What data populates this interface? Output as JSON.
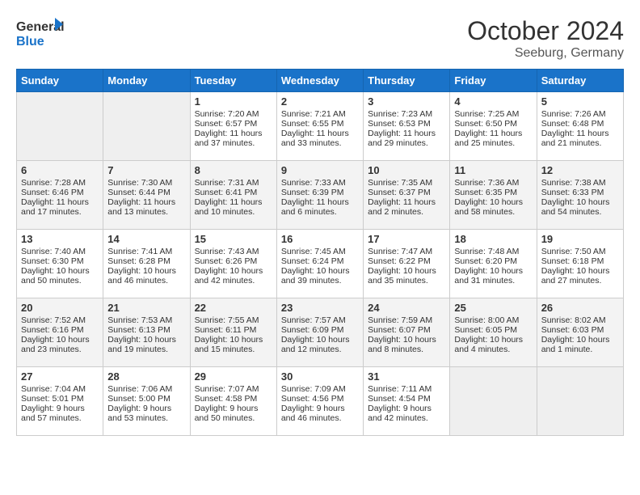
{
  "header": {
    "logo_line1": "General",
    "logo_line2": "Blue",
    "month_title": "October 2024",
    "location": "Seeburg, Germany"
  },
  "days_of_week": [
    "Sunday",
    "Monday",
    "Tuesday",
    "Wednesday",
    "Thursday",
    "Friday",
    "Saturday"
  ],
  "weeks": [
    [
      {
        "day": "",
        "empty": true
      },
      {
        "day": "",
        "empty": true
      },
      {
        "day": "1",
        "sunrise": "Sunrise: 7:20 AM",
        "sunset": "Sunset: 6:57 PM",
        "daylight": "Daylight: 11 hours and 37 minutes."
      },
      {
        "day": "2",
        "sunrise": "Sunrise: 7:21 AM",
        "sunset": "Sunset: 6:55 PM",
        "daylight": "Daylight: 11 hours and 33 minutes."
      },
      {
        "day": "3",
        "sunrise": "Sunrise: 7:23 AM",
        "sunset": "Sunset: 6:53 PM",
        "daylight": "Daylight: 11 hours and 29 minutes."
      },
      {
        "day": "4",
        "sunrise": "Sunrise: 7:25 AM",
        "sunset": "Sunset: 6:50 PM",
        "daylight": "Daylight: 11 hours and 25 minutes."
      },
      {
        "day": "5",
        "sunrise": "Sunrise: 7:26 AM",
        "sunset": "Sunset: 6:48 PM",
        "daylight": "Daylight: 11 hours and 21 minutes."
      }
    ],
    [
      {
        "day": "6",
        "sunrise": "Sunrise: 7:28 AM",
        "sunset": "Sunset: 6:46 PM",
        "daylight": "Daylight: 11 hours and 17 minutes."
      },
      {
        "day": "7",
        "sunrise": "Sunrise: 7:30 AM",
        "sunset": "Sunset: 6:44 PM",
        "daylight": "Daylight: 11 hours and 13 minutes."
      },
      {
        "day": "8",
        "sunrise": "Sunrise: 7:31 AM",
        "sunset": "Sunset: 6:41 PM",
        "daylight": "Daylight: 11 hours and 10 minutes."
      },
      {
        "day": "9",
        "sunrise": "Sunrise: 7:33 AM",
        "sunset": "Sunset: 6:39 PM",
        "daylight": "Daylight: 11 hours and 6 minutes."
      },
      {
        "day": "10",
        "sunrise": "Sunrise: 7:35 AM",
        "sunset": "Sunset: 6:37 PM",
        "daylight": "Daylight: 11 hours and 2 minutes."
      },
      {
        "day": "11",
        "sunrise": "Sunrise: 7:36 AM",
        "sunset": "Sunset: 6:35 PM",
        "daylight": "Daylight: 10 hours and 58 minutes."
      },
      {
        "day": "12",
        "sunrise": "Sunrise: 7:38 AM",
        "sunset": "Sunset: 6:33 PM",
        "daylight": "Daylight: 10 hours and 54 minutes."
      }
    ],
    [
      {
        "day": "13",
        "sunrise": "Sunrise: 7:40 AM",
        "sunset": "Sunset: 6:30 PM",
        "daylight": "Daylight: 10 hours and 50 minutes."
      },
      {
        "day": "14",
        "sunrise": "Sunrise: 7:41 AM",
        "sunset": "Sunset: 6:28 PM",
        "daylight": "Daylight: 10 hours and 46 minutes."
      },
      {
        "day": "15",
        "sunrise": "Sunrise: 7:43 AM",
        "sunset": "Sunset: 6:26 PM",
        "daylight": "Daylight: 10 hours and 42 minutes."
      },
      {
        "day": "16",
        "sunrise": "Sunrise: 7:45 AM",
        "sunset": "Sunset: 6:24 PM",
        "daylight": "Daylight: 10 hours and 39 minutes."
      },
      {
        "day": "17",
        "sunrise": "Sunrise: 7:47 AM",
        "sunset": "Sunset: 6:22 PM",
        "daylight": "Daylight: 10 hours and 35 minutes."
      },
      {
        "day": "18",
        "sunrise": "Sunrise: 7:48 AM",
        "sunset": "Sunset: 6:20 PM",
        "daylight": "Daylight: 10 hours and 31 minutes."
      },
      {
        "day": "19",
        "sunrise": "Sunrise: 7:50 AM",
        "sunset": "Sunset: 6:18 PM",
        "daylight": "Daylight: 10 hours and 27 minutes."
      }
    ],
    [
      {
        "day": "20",
        "sunrise": "Sunrise: 7:52 AM",
        "sunset": "Sunset: 6:16 PM",
        "daylight": "Daylight: 10 hours and 23 minutes."
      },
      {
        "day": "21",
        "sunrise": "Sunrise: 7:53 AM",
        "sunset": "Sunset: 6:13 PM",
        "daylight": "Daylight: 10 hours and 19 minutes."
      },
      {
        "day": "22",
        "sunrise": "Sunrise: 7:55 AM",
        "sunset": "Sunset: 6:11 PM",
        "daylight": "Daylight: 10 hours and 15 minutes."
      },
      {
        "day": "23",
        "sunrise": "Sunrise: 7:57 AM",
        "sunset": "Sunset: 6:09 PM",
        "daylight": "Daylight: 10 hours and 12 minutes."
      },
      {
        "day": "24",
        "sunrise": "Sunrise: 7:59 AM",
        "sunset": "Sunset: 6:07 PM",
        "daylight": "Daylight: 10 hours and 8 minutes."
      },
      {
        "day": "25",
        "sunrise": "Sunrise: 8:00 AM",
        "sunset": "Sunset: 6:05 PM",
        "daylight": "Daylight: 10 hours and 4 minutes."
      },
      {
        "day": "26",
        "sunrise": "Sunrise: 8:02 AM",
        "sunset": "Sunset: 6:03 PM",
        "daylight": "Daylight: 10 hours and 1 minute."
      }
    ],
    [
      {
        "day": "27",
        "sunrise": "Sunrise: 7:04 AM",
        "sunset": "Sunset: 5:01 PM",
        "daylight": "Daylight: 9 hours and 57 minutes."
      },
      {
        "day": "28",
        "sunrise": "Sunrise: 7:06 AM",
        "sunset": "Sunset: 5:00 PM",
        "daylight": "Daylight: 9 hours and 53 minutes."
      },
      {
        "day": "29",
        "sunrise": "Sunrise: 7:07 AM",
        "sunset": "Sunset: 4:58 PM",
        "daylight": "Daylight: 9 hours and 50 minutes."
      },
      {
        "day": "30",
        "sunrise": "Sunrise: 7:09 AM",
        "sunset": "Sunset: 4:56 PM",
        "daylight": "Daylight: 9 hours and 46 minutes."
      },
      {
        "day": "31",
        "sunrise": "Sunrise: 7:11 AM",
        "sunset": "Sunset: 4:54 PM",
        "daylight": "Daylight: 9 hours and 42 minutes."
      },
      {
        "day": "",
        "empty": true
      },
      {
        "day": "",
        "empty": true
      }
    ]
  ]
}
